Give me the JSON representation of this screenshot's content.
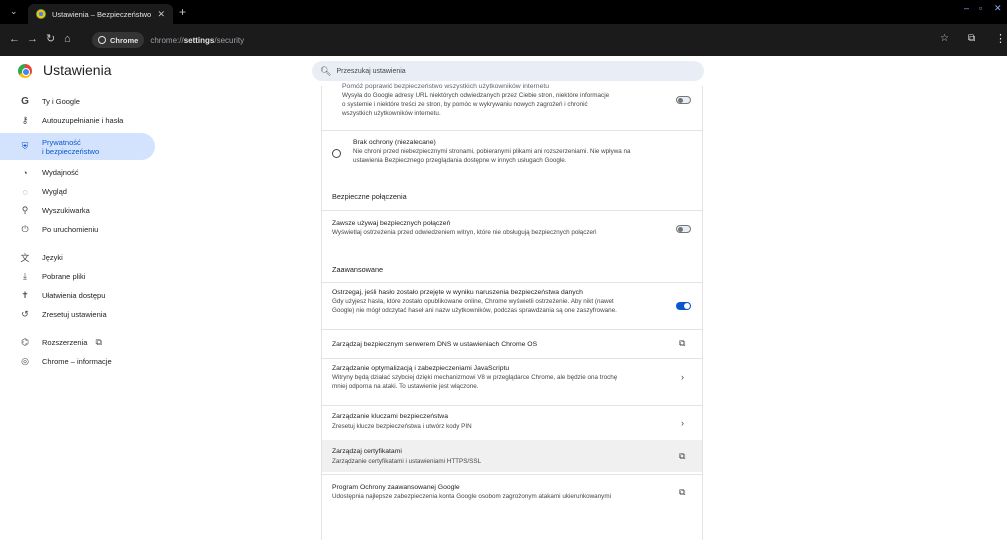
{
  "browser": {
    "tab_title": "Ustawienia – Bezpieczeństwo",
    "chip_label": "Chrome",
    "url_prefix": "chrome://",
    "url_bold": "settings",
    "url_suffix": "/security"
  },
  "header": {
    "title": "Ustawienia",
    "search_placeholder": "Przeszukaj ustawienia"
  },
  "sidebar": {
    "items": [
      {
        "label": "Ty i Google",
        "icon": "google-g-icon"
      },
      {
        "label": "Autouzupełnianie i hasła",
        "icon": "key-icon"
      },
      {
        "label": "Prywatność i bezpieczeństwo",
        "line1": "Prywatność",
        "line2": "i bezpieczeństwo",
        "icon": "shield-icon"
      },
      {
        "label": "Wydajność",
        "icon": "speedometer-icon"
      },
      {
        "label": "Wygląd",
        "icon": "palette-icon"
      },
      {
        "label": "Wyszukiwarka",
        "icon": "search-icon"
      },
      {
        "label": "Po uruchomieniu",
        "icon": "power-icon"
      },
      {
        "label": "Języki",
        "icon": "translate-icon"
      },
      {
        "label": "Pobrane pliki",
        "icon": "download-icon"
      },
      {
        "label": "Ułatwienia dostępu",
        "icon": "accessibility-icon"
      },
      {
        "label": "Zresetuj ustawienia",
        "icon": "reset-icon"
      },
      {
        "label": "Rozszerzenia",
        "icon": "puzzle-icon"
      },
      {
        "label": "Chrome – informacje",
        "icon": "chrome-icon"
      }
    ]
  },
  "content": {
    "top_partial": {
      "title": "Pomóż poprawić bezpieczeństwo wszystkich użytkowników internetu",
      "desc_line1": "Wysyła do Google adresy URL niektórych odwiedzanych przez Ciebie stron, niektóre informacje",
      "desc_line2": "o systemie i niektóre treści ze stron, by pomóc w wykrywaniu nowych zagrożeń i chronić",
      "desc_line3": "wszystkich użytkowników internetu."
    },
    "no_protection": {
      "title": "Brak ochrony (niezalecane)",
      "desc_line1": "Nie chroni przed niebezpiecznymi stronami, pobieranymi plikami ani rozszerzeniami. Nie wpływa na",
      "desc_line2": "ustawienia Bezpiecznego przeglądania dostępne w innych usługach Google."
    },
    "secure_connections_header": "Bezpieczne połączenia",
    "always_secure": {
      "title": "Zawsze używaj bezpiecznych połączeń",
      "desc": "Wyświetlaj ostrzeżenia przed odwiedzeniem witryn, które nie obsługują bezpiecznych połączeń"
    },
    "advanced_header": "Zaawansowane",
    "password_warning": {
      "title": "Ostrzegaj, jeśli hasło zostało przejęte w wyniku naruszenia bezpieczeństwa danych",
      "desc_line1": "Gdy użyjesz hasła, które zostało opublikowane online, Chrome wyświetli ostrzeżenie. Aby nikt (nawet",
      "desc_line2": "Google) nie mógł odczytać haseł ani nazw użytkowników, podczas sprawdzania są one zaszyfrowane."
    },
    "dns": {
      "title": "Zarządzaj bezpiecznym serwerem DNS w ustawieniach Chrome OS"
    },
    "js_optimization": {
      "title": "Zarządzanie optymalizacją i zabezpieczeniami JavaScriptu",
      "desc_line1": "Witryny będą działać szybciej dzięki mechanizmowi V8 w przeglądarce Chrome, ale będzie ona trochę",
      "desc_line2": "mniej odporna na ataki. To ustawienie jest włączone."
    },
    "security_keys": {
      "title": "Zarządzanie kluczami bezpieczeństwa",
      "desc": "Zresetuj klucze bezpieczeństwa i utwórz kody PIN"
    },
    "certificates": {
      "title": "Zarządzaj certyfikatami",
      "desc": "Zarządzanie certyfikatami i ustawieniami HTTPS/SSL"
    },
    "advanced_protection": {
      "title": "Program Ochrony zaawansowanej Google",
      "desc": "Udostępnia najlepsze zabezpieczenia konta Google osobom zagrożonym atakami ukierunkowanymi"
    }
  }
}
